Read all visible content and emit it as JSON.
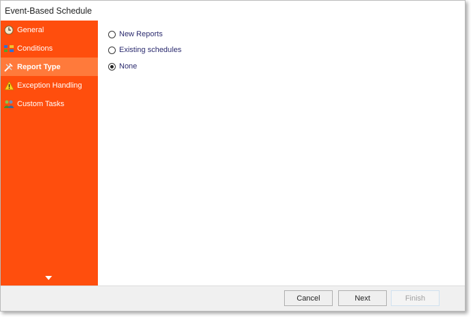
{
  "window": {
    "title": "Event-Based Schedule"
  },
  "sidebar": {
    "items": [
      {
        "label": "General",
        "icon": "clock-icon",
        "active": false
      },
      {
        "label": "Conditions",
        "icon": "conditions-icon",
        "active": false
      },
      {
        "label": "Report Type",
        "icon": "tools-icon",
        "active": true
      },
      {
        "label": "Exception Handling",
        "icon": "warning-icon",
        "active": false
      },
      {
        "label": "Custom Tasks",
        "icon": "people-icon",
        "active": false
      }
    ],
    "scroll_icon": "caret-down-icon",
    "background_color": "#ff4e0d",
    "active_color": "#ff7a3b"
  },
  "report_type": {
    "options": [
      {
        "label": "New Reports",
        "checked": false
      },
      {
        "label": "Existing schedules",
        "checked": false
      },
      {
        "label": "None",
        "checked": true
      }
    ]
  },
  "footer": {
    "cancel_label": "Cancel",
    "next_label": "Next",
    "finish_label": "Finish",
    "finish_enabled": false
  }
}
